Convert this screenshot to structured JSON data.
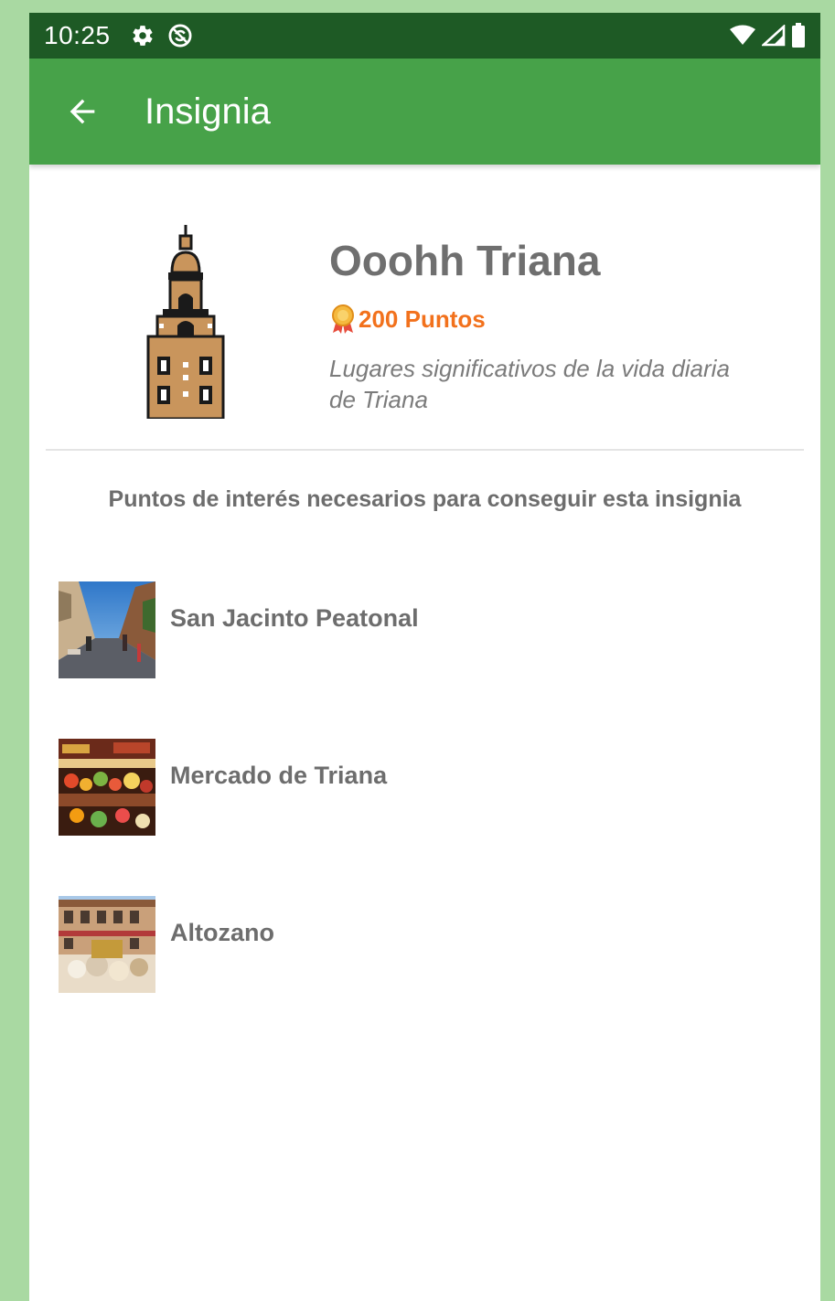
{
  "status_bar": {
    "time": "10:25",
    "icons": [
      "gear-icon",
      "no-sync-icon",
      "wifi-icon",
      "signal-icon",
      "battery-icon"
    ]
  },
  "app_bar": {
    "title": "Insignia",
    "back_icon": "arrow-back-icon"
  },
  "badge": {
    "name": "Ooohh Triana",
    "points": "200 Puntos",
    "description": "Lugares significativos de la vida diaria de Triana",
    "icon": "tower-icon",
    "points_icon": "medal-icon"
  },
  "poi_section": {
    "heading": "Puntos de interés necesarios para conseguir esta insignia"
  },
  "poi_items": [
    {
      "label": "San Jacinto Peatonal",
      "thumb": "street-photo"
    },
    {
      "label": "Mercado de Triana",
      "thumb": "market-photo"
    },
    {
      "label": "Altozano",
      "thumb": "plaza-photo"
    }
  ],
  "colors": {
    "status_bar": "#1e5a25",
    "app_bar": "#47a249",
    "points": "#f2711c",
    "background": "#a9d9a2"
  }
}
